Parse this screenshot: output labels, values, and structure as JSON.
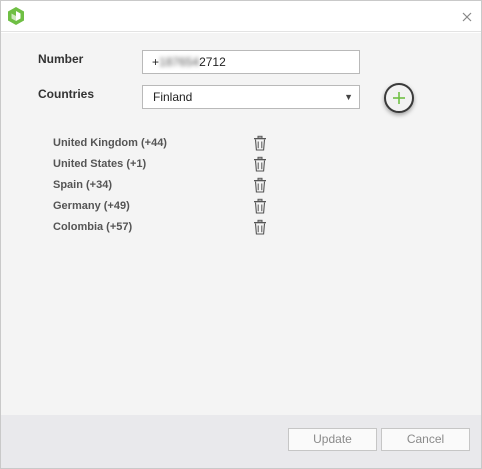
{
  "form": {
    "number_label": "Number",
    "number_prefix": "+",
    "number_blurred": "187654",
    "number_suffix": "2712",
    "countries_label": "Countries",
    "countries_selected": "Finland"
  },
  "countries": [
    {
      "label": "United Kingdom (+44)"
    },
    {
      "label": "United States (+1)"
    },
    {
      "label": "Spain (+34)"
    },
    {
      "label": "Germany (+49)"
    },
    {
      "label": "Colombia (+57)"
    }
  ],
  "footer": {
    "update_label": "Update",
    "cancel_label": "Cancel"
  },
  "icons": {
    "app": "app-logo-icon",
    "close": "close-icon",
    "add": "plus-icon",
    "delete": "trash-icon",
    "dropdown": "chevron-down-icon"
  },
  "colors": {
    "accent": "#6fbf44",
    "content_bg": "#f4f4f4",
    "footer_bg": "#e9e9ec"
  }
}
